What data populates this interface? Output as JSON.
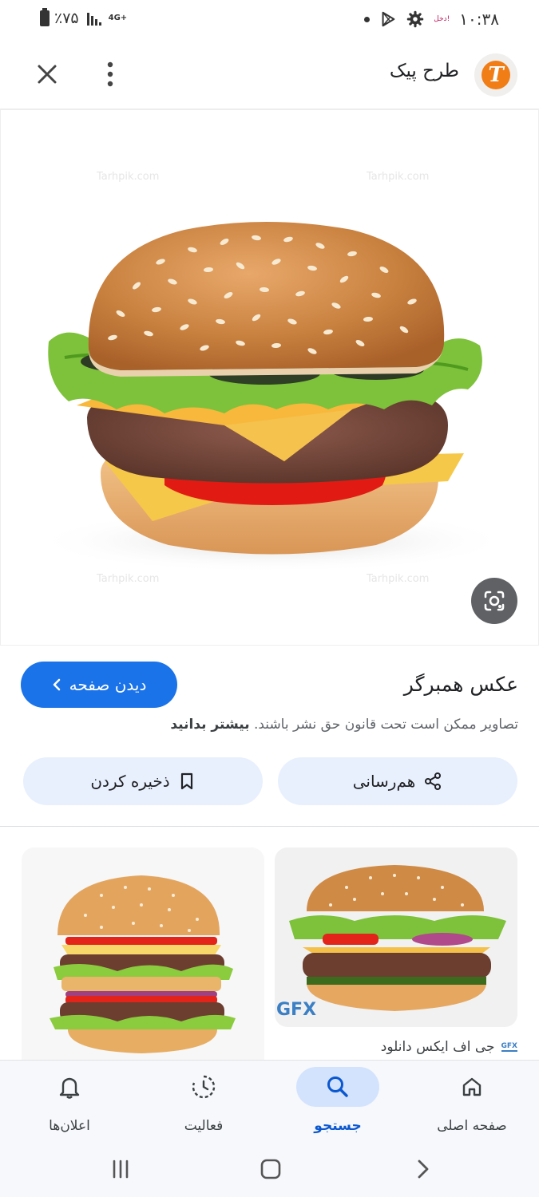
{
  "status_bar": {
    "battery": "٪۷۵",
    "network": "4G+",
    "carrier_tag": "دخل!",
    "time": "۱۰:۳۸"
  },
  "header": {
    "site_name": "طرح پیک",
    "logo_letter": "T",
    "accent": "#f07d16"
  },
  "image": {
    "watermark": "Tarhpik.com",
    "lens_icon": "google-lens-icon"
  },
  "details": {
    "title": "عکس همبرگر",
    "view_button": "دیدن صفحه",
    "copyright_text": "تصاویر ممکن است تحت قانون حق نشر باشند.",
    "learn_more": "بیشتر بدانید",
    "primary_color": "#1a73e8"
  },
  "actions": {
    "share": "هم‌رسانی",
    "save": "ذخیره کردن"
  },
  "related": {
    "right_card_source": "جی اف ایکس دانلود",
    "right_card_badge": "GFX",
    "right_card_logo": "GFX"
  },
  "bottom_nav": {
    "items": [
      {
        "label": "صفحه اصلی",
        "icon": "home-icon"
      },
      {
        "label": "جستجو",
        "icon": "search-icon",
        "active": true
      },
      {
        "label": "فعالیت",
        "icon": "history-icon"
      },
      {
        "label": "اعلان‌ها",
        "icon": "bell-icon"
      }
    ]
  }
}
